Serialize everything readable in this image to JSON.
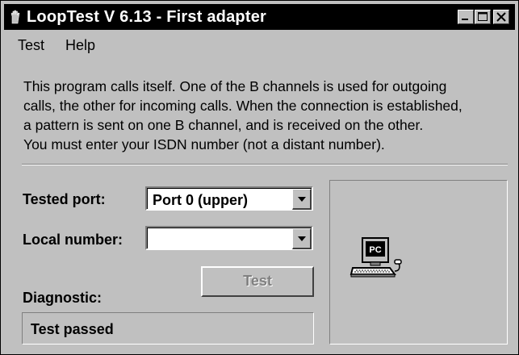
{
  "window": {
    "title": "LoopTest V 6.13 - First adapter",
    "controls": {
      "minimize": "minimize-icon",
      "maximize": "maximize-icon",
      "close": "close-icon"
    }
  },
  "menubar": {
    "items": [
      {
        "label": "Test"
      },
      {
        "label": "Help"
      }
    ]
  },
  "info": {
    "lines": [
      "This program calls itself. One of the B channels is used for outgoing",
      "calls, the other for incoming calls. When the connection is established,",
      "a pattern is sent on one B channel, and is received on the other.",
      "You must enter your ISDN number (not a distant number)."
    ]
  },
  "form": {
    "tested_port_label": "Tested port:",
    "tested_port_value": "Port 0 (upper)",
    "local_number_label": "Local number:",
    "local_number_value": "",
    "test_button_label": "Test",
    "test_button_enabled": false
  },
  "diagnostic": {
    "label": "Diagnostic:",
    "value": "Test passed"
  },
  "status_panel": {
    "icon": "pc-icon",
    "icon_text": "PC"
  },
  "colors": {
    "titlebar_bg": "#000000",
    "face": "#c0c0c0",
    "disabled_text": "#808080"
  }
}
